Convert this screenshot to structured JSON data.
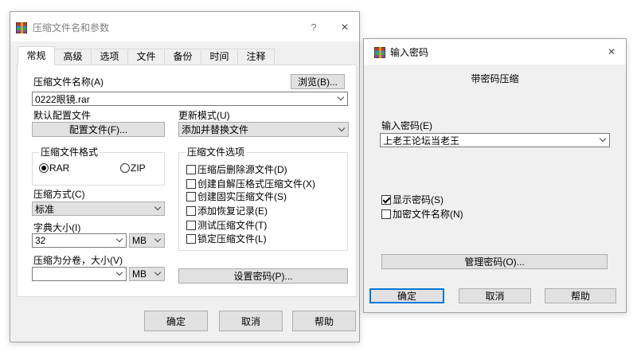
{
  "left_dialog": {
    "title": "压缩文件名和参数",
    "help_glyph": "?",
    "close_glyph": "×",
    "tabs": [
      {
        "label": "常规",
        "selected": true
      },
      {
        "label": "高级",
        "selected": false
      },
      {
        "label": "选项",
        "selected": false
      },
      {
        "label": "文件",
        "selected": false
      },
      {
        "label": "备份",
        "selected": false
      },
      {
        "label": "时间",
        "selected": false
      },
      {
        "label": "注释",
        "selected": false
      }
    ],
    "general": {
      "archive_name": {
        "label": "压缩文件名称(A)",
        "value": "0222眼镜.rar",
        "browse_button": "浏览(B)..."
      },
      "profile": {
        "label": "默认配置文件",
        "button": "配置文件(F)..."
      },
      "update_mode": {
        "label": "更新模式(U)",
        "value": "添加并替换文件"
      },
      "archive_format": {
        "label": "压缩文件格式",
        "options": [
          {
            "label": "RAR",
            "selected": true
          },
          {
            "label": "ZIP",
            "selected": false
          }
        ]
      },
      "compression_method": {
        "label": "压缩方式(C)",
        "value": "标准"
      },
      "dictionary_size": {
        "label": "字典大小(I)",
        "value": "32",
        "unit": "MB"
      },
      "split_volumes": {
        "label": "压缩为分卷，大小(V)",
        "value": "",
        "unit": "MB"
      },
      "archive_options": {
        "label": "压缩文件选项",
        "items": [
          {
            "label": "压缩后删除源文件(D)",
            "checked": false
          },
          {
            "label": "创建自解压格式压缩文件(X)",
            "checked": false
          },
          {
            "label": "创建固实压缩文件(S)",
            "checked": false
          },
          {
            "label": "添加恢复记录(E)",
            "checked": false
          },
          {
            "label": "测试压缩文件(T)",
            "checked": false
          },
          {
            "label": "锁定压缩文件(L)",
            "checked": false
          }
        ]
      },
      "set_password_button": "设置密码(P)..."
    },
    "buttons": {
      "ok": "确定",
      "cancel": "取消",
      "help": "帮助"
    }
  },
  "password_dialog": {
    "title": "输入密码",
    "close_glyph": "×",
    "heading": "带密码压缩",
    "password": {
      "label": "输入密码(E)",
      "value": "上老王论坛当老王"
    },
    "show_password": {
      "label": "显示密码(S)",
      "checked": true
    },
    "encrypt_file_names": {
      "label": "加密文件名称(N)",
      "checked": false
    },
    "manage_button": "管理密码(O)...",
    "buttons": {
      "ok": "确定",
      "cancel": "取消",
      "help": "帮助"
    }
  },
  "icons": {
    "app": "winrar-books-icon",
    "dropdown": "chevron-down-icon",
    "check": "checkmark-icon"
  },
  "colors": {
    "dialog_bg": "#f0f0f0",
    "tab_page_bg": "#ffffff",
    "button_bg": "#e1e1e1",
    "button_border": "#adadad",
    "default_button_border": "#0078d7",
    "inactive_title_text": "#808080"
  }
}
